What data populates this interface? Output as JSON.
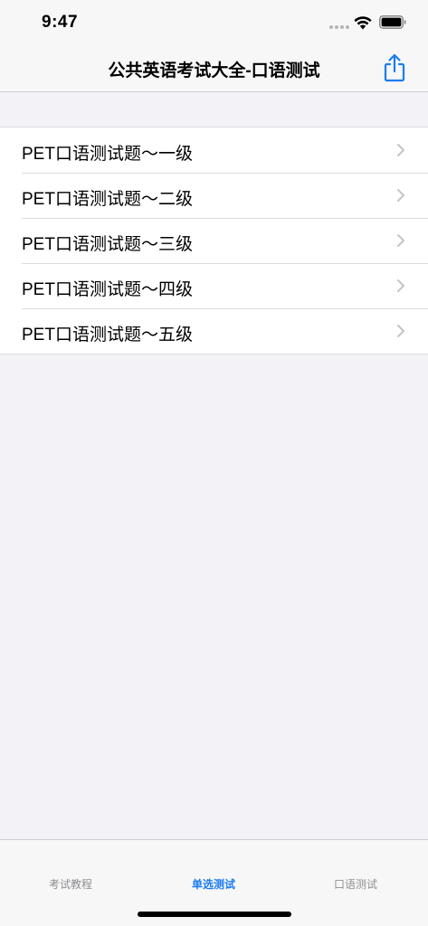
{
  "status_bar": {
    "time": "9:47",
    "wifi_icon": "wifi-icon",
    "battery_icon": "battery-icon"
  },
  "nav": {
    "title": "公共英语考试大全-口语测试",
    "share_icon": "share-icon",
    "accent_color": "#1a7cf0"
  },
  "list": {
    "items": [
      {
        "label": "PET口语测试题～一级"
      },
      {
        "label": "PET口语测试题～二级"
      },
      {
        "label": "PET口语测试题～三级"
      },
      {
        "label": "PET口语测试题～四级"
      },
      {
        "label": "PET口语测试题～五级"
      }
    ],
    "chevron_icon": "chevron-right-icon"
  },
  "tab_bar": {
    "tabs": [
      {
        "label": "考试教程",
        "active": false
      },
      {
        "label": "单选测试",
        "active": true
      },
      {
        "label": "口语测试",
        "active": false
      }
    ]
  }
}
